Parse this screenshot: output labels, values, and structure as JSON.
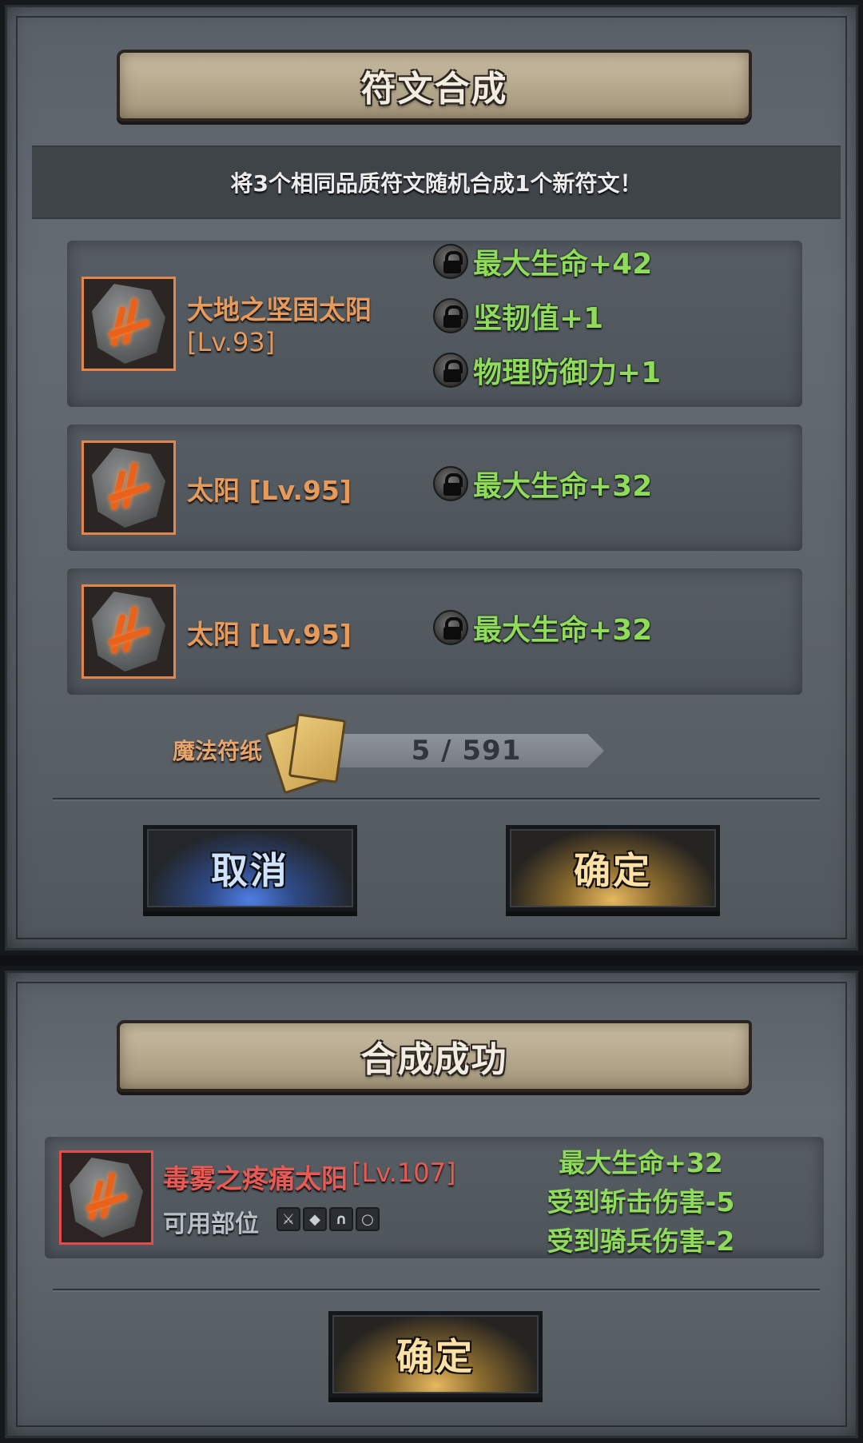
{
  "synth": {
    "title": "符文合成",
    "description": "将3个相同品质符文随机合成1个新符文！",
    "runes": [
      {
        "name": "大地之坚固太阳",
        "level": "[Lv.93]",
        "attrs": [
          "最大生命+42",
          "坚韧值+1",
          "物理防御力+1"
        ]
      },
      {
        "name": "太阳 [Lv.95]",
        "attrs": [
          "最大生命+32"
        ]
      },
      {
        "name": "太阳 [Lv.95]",
        "attrs": [
          "最大生命+32"
        ]
      }
    ],
    "paper": {
      "label": "魔法符纸",
      "count": "5 / 591"
    },
    "cancel_label": "取消",
    "confirm_label": "确定"
  },
  "result": {
    "title": "合成成功",
    "rune_name": "毒雾之疼痛太阳",
    "rune_level": "[Lv.107]",
    "part_label": "可用部位",
    "attrs": [
      "最大生命+32",
      "受到斩击伤害-5",
      "受到骑兵伤害-2"
    ],
    "confirm_label": "确定"
  },
  "colors": {
    "rune_name": "#e89a5a",
    "result_name": "#ea5a55",
    "attr_green": "#8edc5a",
    "cancel_blue": "#4f7ee2",
    "confirm_gold": "#e6b860"
  },
  "icons": [
    "rune-stone-icon",
    "lock-icon",
    "magic-paper-icon",
    "part-weapon-icon",
    "part-armor-icon",
    "part-boots-icon",
    "part-ring-icon"
  ]
}
